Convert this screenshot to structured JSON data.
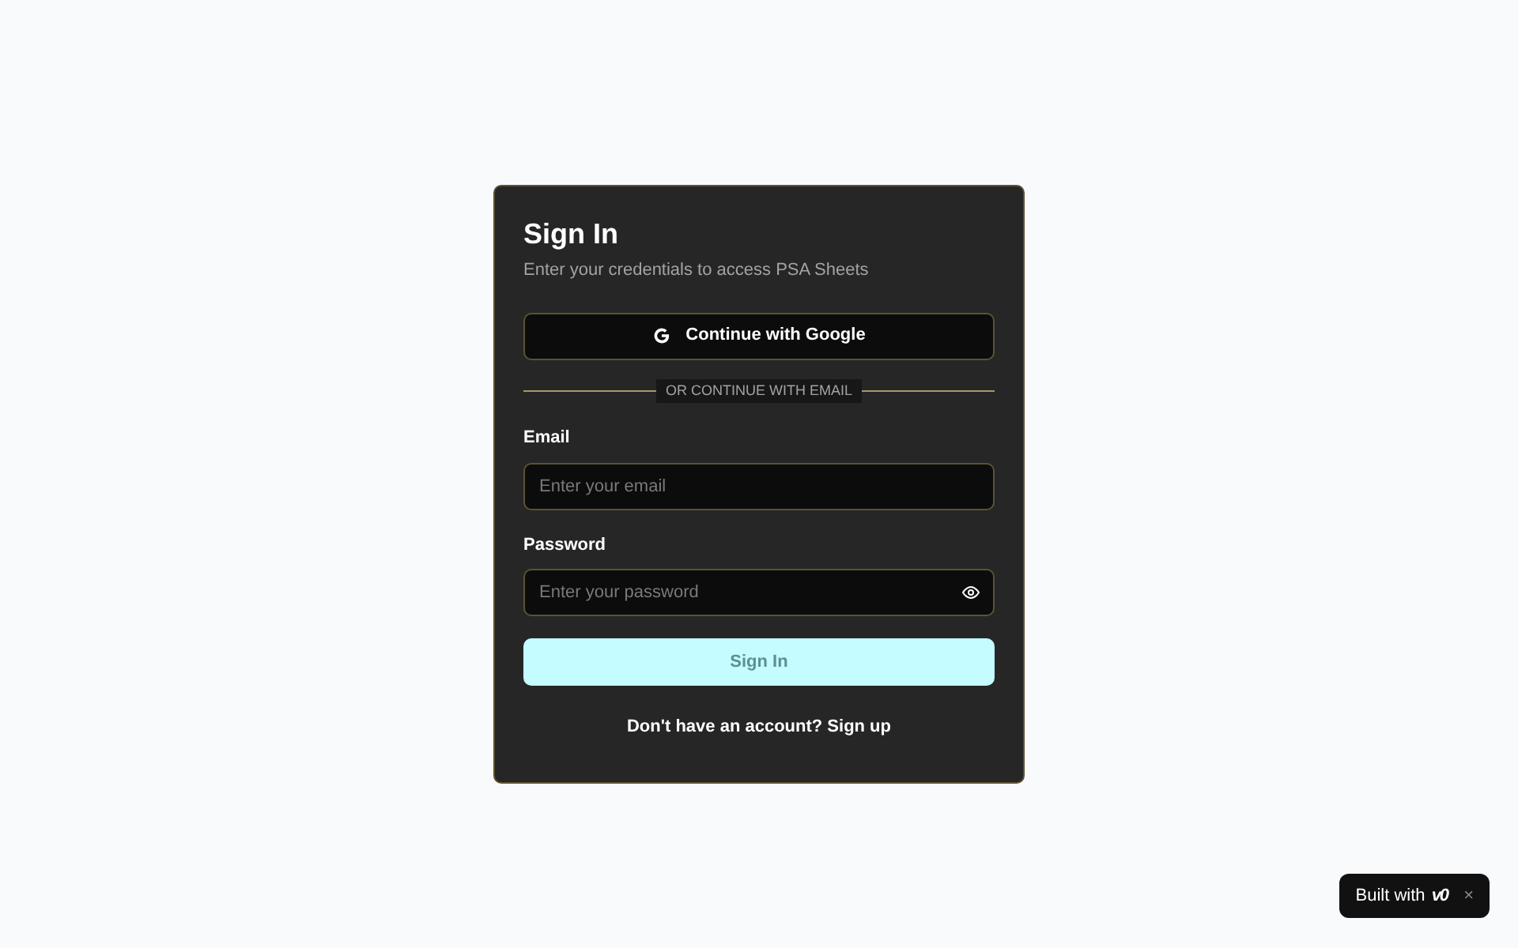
{
  "card": {
    "title": "Sign In",
    "subtitle": "Enter your credentials to access PSA Sheets"
  },
  "google_button": {
    "label": "Continue with Google"
  },
  "divider": {
    "label": "OR CONTINUE WITH EMAIL"
  },
  "fields": [
    {
      "label": "Email",
      "placeholder": "Enter your email",
      "kind": "text"
    },
    {
      "label": "Password",
      "placeholder": "Enter your password",
      "kind": "password"
    }
  ],
  "submit": {
    "label": "Sign In",
    "disabled": true
  },
  "signup_link": {
    "label": "Don't have an account? Sign up"
  },
  "badge": {
    "label": "Built with",
    "logo": "v0",
    "close": "×"
  }
}
